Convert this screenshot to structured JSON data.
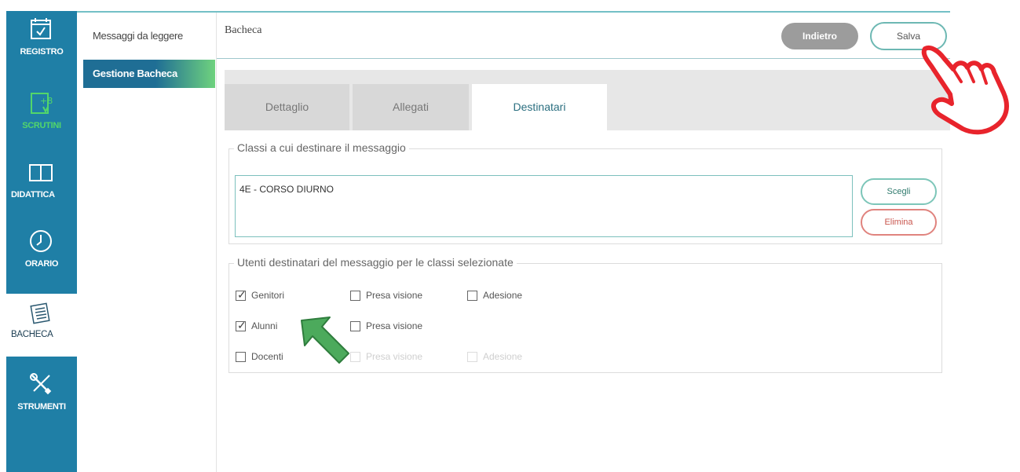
{
  "rail": {
    "items": [
      {
        "label": "REGISTRO",
        "icon": "calendar-check-icon"
      },
      {
        "label": "SCRUTINI",
        "icon": "grade-sheet-icon"
      },
      {
        "label": "DIDATTICA",
        "icon": "book-icon"
      },
      {
        "label": "ORARIO",
        "icon": "clock-icon"
      },
      {
        "label": "BACHECA",
        "icon": "notice-board-icon"
      },
      {
        "label": "STRUMENTI",
        "icon": "tools-icon"
      }
    ]
  },
  "submenu": {
    "items": [
      {
        "label": "Messaggi da leggere"
      },
      {
        "label": "Gestione Bacheca"
      }
    ]
  },
  "header": {
    "title": "Bacheca",
    "back_label": "Indietro",
    "save_label": "Salva"
  },
  "tabs": [
    {
      "label": "Dettaglio"
    },
    {
      "label": "Allegati"
    },
    {
      "label": "Destinatari"
    }
  ],
  "classes": {
    "legend": "Classi a cui destinare il messaggio",
    "selected": "4E - CORSO DIURNO",
    "choose_label": "Scegli",
    "delete_label": "Elimina"
  },
  "recipients": {
    "legend": "Utenti destinatari del messaggio per le classi selezionate",
    "rows": [
      {
        "label": "Genitori",
        "checked": true,
        "presa": "Presa visione",
        "adesione": "Adesione"
      },
      {
        "label": "Alunni",
        "checked": true,
        "presa": "Presa visione"
      },
      {
        "label": "Docenti",
        "checked": false,
        "presa": "Presa visione",
        "adesione": "Adesione"
      }
    ]
  },
  "colors": {
    "rail": "#1f7fa6",
    "accent_teal": "#6db8b3",
    "danger": "#e0837e",
    "pointer_hand": "#e8242c",
    "pointer_arrow": "#4caa5c"
  }
}
